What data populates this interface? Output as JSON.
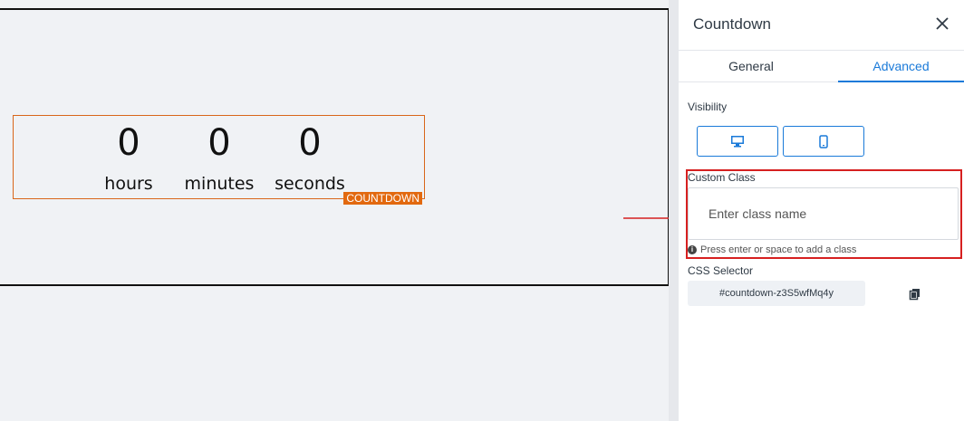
{
  "countdown": {
    "hours_value": "0",
    "minutes_value": "0",
    "seconds_value": "0",
    "hours_label": "hours",
    "minutes_label": "minutes",
    "seconds_label": "seconds",
    "tag": "COUNTDOWN"
  },
  "panel": {
    "title": "Countdown",
    "tabs": [
      {
        "label": "General",
        "active": false
      },
      {
        "label": "Advanced",
        "active": true
      }
    ],
    "visibility_label": "Visibility",
    "custom_class_label": "Custom Class",
    "custom_class_placeholder": "Enter class name",
    "custom_class_hint": "Press enter or space to add a class",
    "css_selector_label": "CSS Selector",
    "css_selector_value": "#countdown-z3S5wfMq4y"
  },
  "colors": {
    "accent": "#1a7ad9",
    "tag_bg": "#e2690f",
    "highlight": "#d62020"
  }
}
